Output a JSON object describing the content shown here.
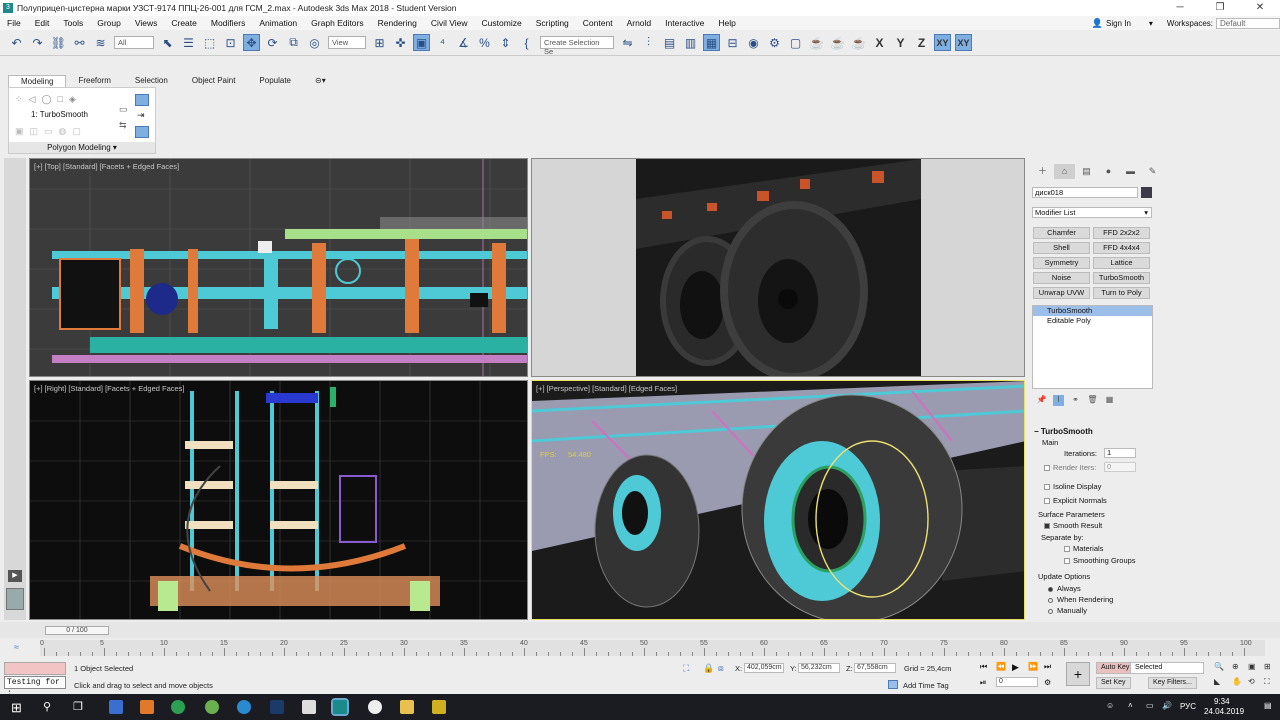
{
  "titlebar": {
    "title": "Полуприцеп-цистерна марки УЗСТ-9174 ППЦ-26-001 для ГСМ_2.max - Autodesk 3ds Max 2018 - Student Version",
    "minimize": "─",
    "maximize": "❐",
    "close": "✕"
  },
  "menu": [
    "File",
    "Edit",
    "Tools",
    "Group",
    "Views",
    "Create",
    "Modifiers",
    "Animation",
    "Graph Editors",
    "Rendering",
    "Civil View",
    "Customize",
    "Scripting",
    "Content",
    "Arnold",
    "Interactive",
    "Help"
  ],
  "signin": "Sign In",
  "workspaces": {
    "label": "Workspaces:",
    "value": "Default"
  },
  "toolbar": {
    "filter": "All",
    "refcoord": "View",
    "selset": "Create Selection Se",
    "axes": [
      "X",
      "Y",
      "Z",
      "XY",
      "XY"
    ]
  },
  "ribbon": {
    "tabs": [
      "Modeling",
      "Freeform",
      "Selection",
      "Object Paint",
      "Populate"
    ],
    "stack_item": "1: TurboSmooth",
    "footer": "Polygon Modeling"
  },
  "viewports": {
    "top": "[+] [Top] [Standard] [Facets + Edged Faces]",
    "right": "[+] [Right] [Standard] [Facets + Edged Faces]",
    "persp": "[+] [Perspective] [Standard] [Edged Faces]",
    "fps_label": "FPS:",
    "fps_value": "54.480"
  },
  "cmdpanel": {
    "object_name": "диск018",
    "modifier_list": "Modifier List",
    "buttons": [
      "Chamfer",
      "FFD 2x2x2",
      "Shell",
      "FFD 4x4x4",
      "Symmetry",
      "Lattice",
      "Noise",
      "TurboSmooth",
      "Unwrap UVW",
      "Turn to Poly"
    ],
    "stack": [
      "TurboSmooth",
      "Editable Poly"
    ],
    "rollout_title": "TurboSmooth",
    "main": "Main",
    "iterations_label": "Iterations:",
    "iterations": "1",
    "render_iters": "Render Iters:",
    "render_iters_value": "0",
    "isoline": "Isoline Display",
    "explicit": "Explicit Normals",
    "surface": "Surface Parameters",
    "smooth_result": "Smooth Result",
    "separate": "Separate by:",
    "materials": "Materials",
    "smoothing_groups": "Smoothing Groups",
    "update": "Update Options",
    "always": "Always",
    "when_rendering": "When Rendering",
    "manually": "Manually"
  },
  "timeline": {
    "slider": "0 / 100",
    "ticks": [
      "0",
      "5",
      "10",
      "15",
      "20",
      "25",
      "30",
      "35",
      "40",
      "45",
      "50",
      "55",
      "60",
      "65",
      "70",
      "75",
      "80",
      "85",
      "90",
      "95",
      "100"
    ]
  },
  "status": {
    "listener": "Testing for :",
    "selected": "1 Object Selected",
    "prompt": "Click and drag to select and move objects",
    "x_label": "X:",
    "x": "402,059cm",
    "y_label": "Y:",
    "y": "56,232cm",
    "z_label": "Z:",
    "z": "67,558cm",
    "grid": "Grid = 25,4cm",
    "add_time_tag": "Add Time Tag",
    "autokey": "Auto Key",
    "setkey": "Set Key",
    "selected_dd": "Selected",
    "keyfilters": "Key Filters...",
    "frame": "0"
  },
  "taskbar": {
    "lang": "РУС",
    "time": "9:34",
    "date": "24.04.2019"
  }
}
